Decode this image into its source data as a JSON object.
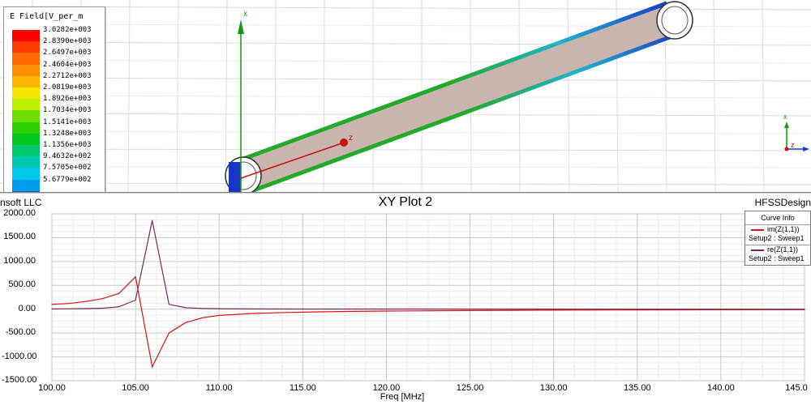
{
  "viewport": {
    "legend": {
      "title": "E Field[V_per_m",
      "entries": [
        {
          "value": "3.0282e+003",
          "color": "#ff0000"
        },
        {
          "value": "2.8390e+003",
          "color": "#ff3a00"
        },
        {
          "value": "2.6497e+003",
          "color": "#ff6a00"
        },
        {
          "value": "2.4604e+003",
          "color": "#ff8e00"
        },
        {
          "value": "2.2712e+003",
          "color": "#ffb400"
        },
        {
          "value": "2.0819e+003",
          "color": "#f4e600"
        },
        {
          "value": "1.8926e+003",
          "color": "#b8f000"
        },
        {
          "value": "1.7034e+003",
          "color": "#6ee000"
        },
        {
          "value": "1.5141e+003",
          "color": "#2ccf00"
        },
        {
          "value": "1.3248e+003",
          "color": "#00c81e"
        },
        {
          "value": "1.1356e+003",
          "color": "#00c873"
        },
        {
          "value": "9.4632e+002",
          "color": "#00c8b0"
        },
        {
          "value": "7.5705e+002",
          "color": "#00c8e8"
        },
        {
          "value": "5.6779e+002",
          "color": "#009cf0"
        },
        {
          "value": "",
          "color": "#0064e0"
        }
      ]
    },
    "axes": {
      "x_label": "x",
      "z_label": "z"
    },
    "triad": {
      "x_label": "x",
      "z_label": "z"
    },
    "colors": {
      "cylinder_fill": "#c6b0aa",
      "edge_green": "#22aa2a",
      "edge_blue": "#1c3cc8",
      "axis_green": "#119911",
      "axis_red": "#cc1111",
      "grid": "#dddddd"
    }
  },
  "plot": {
    "title": "XY Plot 2",
    "brand_left": "nsoft LLC",
    "brand_right": "HFSSDesign",
    "curve_info": {
      "title": "Curve Info",
      "curves": [
        {
          "name": "im(Z(1,1))",
          "setup": "Setup2 : Sweep1",
          "color": "#dd1111"
        },
        {
          "name": "re(Z(1,1))",
          "setup": "Setup2 : Sweep1",
          "color": "#7a2a52"
        }
      ]
    }
  },
  "chart_data": {
    "type": "line",
    "title": "XY Plot 2",
    "xlabel": "Freq [MHz]",
    "ylabel": "",
    "xlim": [
      100,
      145
    ],
    "ylim": [
      -1500,
      2000
    ],
    "x_ticks": [
      "100.00",
      "105.00",
      "110.00",
      "115.00",
      "120.00",
      "125.00",
      "130.00",
      "135.00",
      "140.00",
      "145.0"
    ],
    "y_ticks": [
      "2000.00",
      "1500.00",
      "1000.00",
      "500.00",
      "0.00",
      "-500.00",
      "-1000.00",
      "-1500.00"
    ],
    "grid": true,
    "legend_position": "top-right",
    "series": [
      {
        "name": "im(Z(1,1))",
        "color": "#dd1111",
        "x": [
          100,
          101,
          102,
          103,
          104,
          105,
          106,
          107,
          108,
          109,
          110,
          112,
          114,
          116,
          118,
          120,
          125,
          130,
          135,
          140,
          145
        ],
        "y": [
          100,
          120,
          160,
          220,
          330,
          680,
          -1210,
          -500,
          -280,
          -180,
          -130,
          -90,
          -70,
          -55,
          -45,
          -38,
          -28,
          -20,
          -15,
          -12,
          -10
        ]
      },
      {
        "name": "re(Z(1,1))",
        "color": "#7a2a52",
        "x": [
          100,
          101,
          102,
          103,
          104,
          105,
          106,
          107,
          108,
          109,
          110,
          112,
          115,
          120,
          125,
          130,
          135,
          140,
          145
        ],
        "y": [
          5,
          8,
          12,
          20,
          50,
          190,
          1860,
          100,
          30,
          15,
          10,
          6,
          4,
          3,
          2,
          2,
          1,
          1,
          1
        ]
      }
    ]
  }
}
